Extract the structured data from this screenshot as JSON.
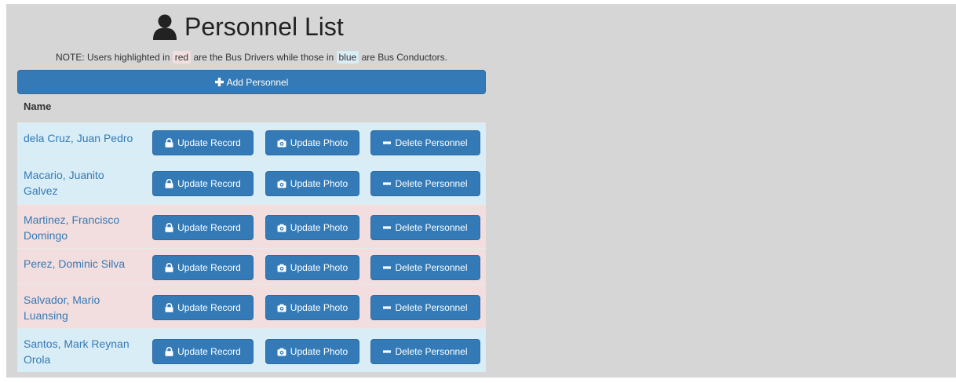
{
  "page": {
    "title": "Personnel List",
    "note": {
      "before": "NOTE: Users highlighted in",
      "red_word": "red",
      "middle": "are the Bus Drivers while those in",
      "blue_word": "blue",
      "after": "are Bus Conductors."
    },
    "add_button_label": "Add Personnel",
    "table_header": "Name"
  },
  "actions": {
    "update_record": "Update Record",
    "update_photo": "Update Photo",
    "delete_personnel": "Delete Personnel"
  },
  "colors": {
    "driver_row": "#f2dede",
    "conductor_row": "#d9edf7",
    "primary_button": "#337ab7"
  },
  "icons": {
    "title": "user-icon",
    "add": "plus-icon",
    "update_record": "lock-icon",
    "update_photo": "camera-icon",
    "delete": "minus-icon"
  },
  "personnel": [
    {
      "name": "dela Cruz, Juan Pedro",
      "role": "conductor"
    },
    {
      "name": "Macario, Juanito Galvez",
      "role": "conductor"
    },
    {
      "name": "Martinez, Francisco Domingo",
      "role": "driver"
    },
    {
      "name": "Perez, Dominic Silva",
      "role": "driver"
    },
    {
      "name": "Salvador, Mario Luansing",
      "role": "driver"
    },
    {
      "name": "Santos, Mark Reynan Orola",
      "role": "conductor"
    }
  ]
}
